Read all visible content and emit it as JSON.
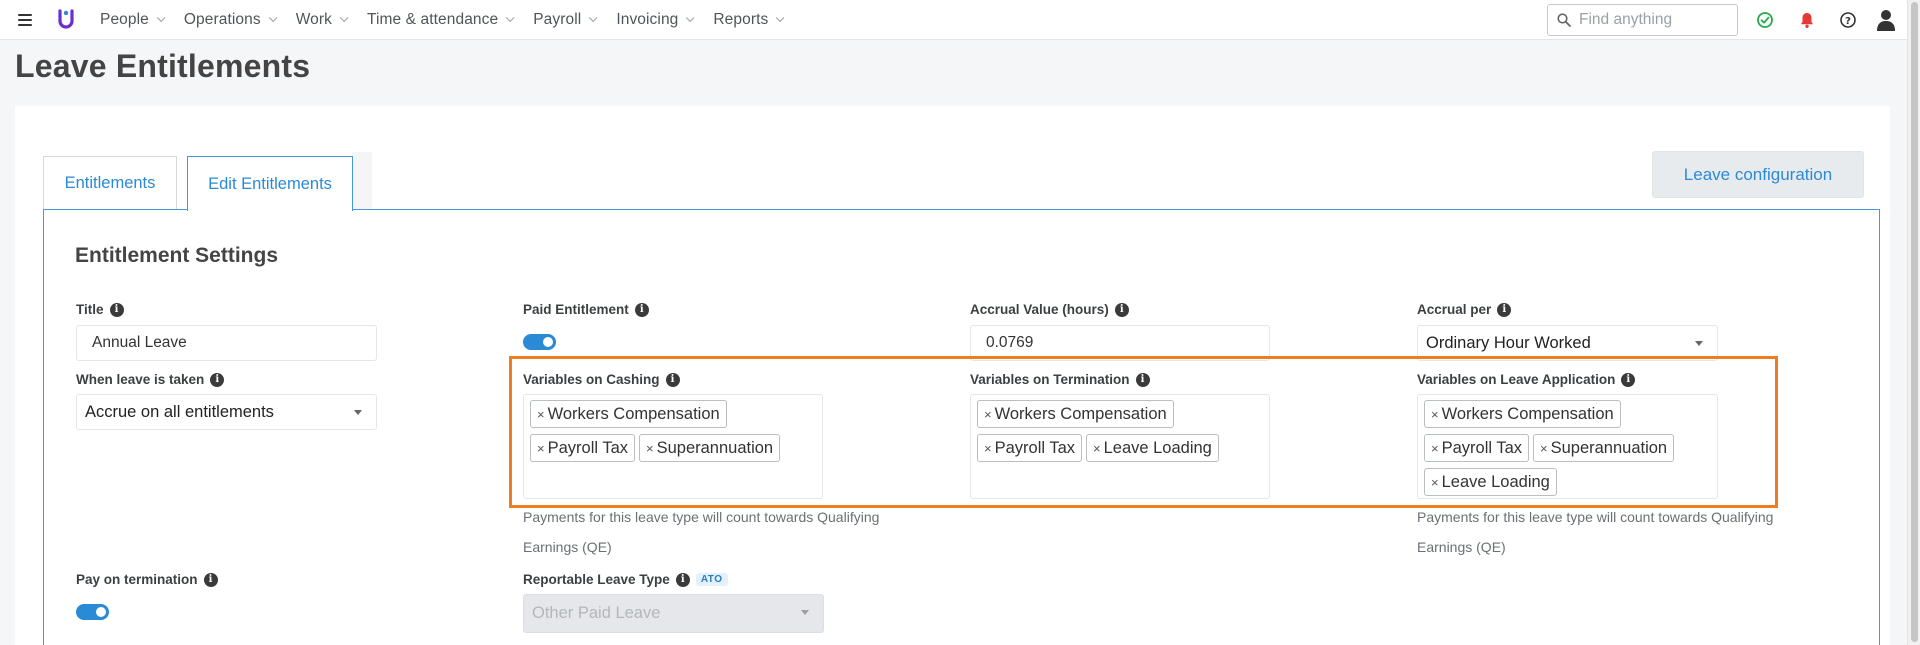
{
  "nav": {
    "items": [
      {
        "label": "People"
      },
      {
        "label": "Operations"
      },
      {
        "label": "Work"
      },
      {
        "label": "Time & attendance"
      },
      {
        "label": "Payroll"
      },
      {
        "label": "Invoicing"
      },
      {
        "label": "Reports"
      }
    ],
    "search_placeholder": "Find anything",
    "brand_color": "#6a2fd0",
    "icons": [
      "menu-icon",
      "logo",
      "search-icon",
      "check-circle-icon",
      "bell-icon",
      "help-icon",
      "user-icon"
    ]
  },
  "page": {
    "title": "Leave Entitlements"
  },
  "tabs": [
    {
      "label": "Entitlements",
      "active": false
    },
    {
      "label": "Edit Entitlements",
      "active": true
    }
  ],
  "leave_config_button": "Leave configuration",
  "section_title": "Entitlement Settings",
  "fields": {
    "title": {
      "label": "Title",
      "value": "Annual Leave"
    },
    "paid_entitlement": {
      "label": "Paid Entitlement",
      "on": true
    },
    "accrual_value": {
      "label": "Accrual Value (hours)",
      "value": "0.0769"
    },
    "accrual_per": {
      "label": "Accrual per",
      "value": "Ordinary Hour Worked"
    },
    "when_leave_taken": {
      "label": "When leave is taken",
      "value": "Accrue on all entitlements"
    },
    "variables_cashing": {
      "label": "Variables on Cashing",
      "chips": [
        "Workers Compensation",
        "Payroll Tax",
        "Superannuation"
      ]
    },
    "variables_termination": {
      "label": "Variables on Termination",
      "chips": [
        "Workers Compensation",
        "Payroll Tax",
        "Leave Loading"
      ]
    },
    "variables_leave_application": {
      "label": "Variables on Leave Application",
      "chips": [
        "Workers Compensation",
        "Payroll Tax",
        "Superannuation",
        "Leave Loading"
      ]
    },
    "qe_help_1": "Payments for this leave type will count towards Qualifying",
    "qe_help_2": "Earnings (QE)",
    "pay_on_termination": {
      "label": "Pay on termination",
      "on": true
    },
    "reportable_leave_type": {
      "label": "Reportable Leave Type",
      "badge": "ATO",
      "value": "Other Paid Leave"
    }
  },
  "colors": {
    "accent": "#2b8ad6",
    "highlight": "#ee7d1f"
  }
}
